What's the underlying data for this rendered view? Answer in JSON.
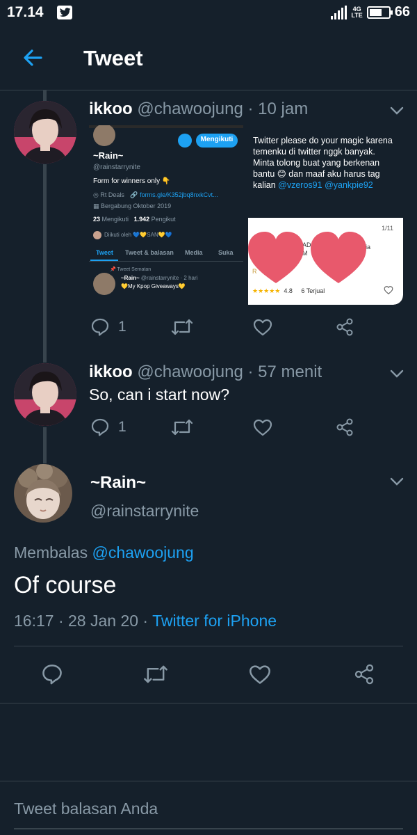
{
  "status_bar": {
    "time": "17.14",
    "network": "4G",
    "network_sub": "LTE",
    "battery": "66"
  },
  "header": {
    "title": "Tweet"
  },
  "tweets": [
    {
      "name": "ikkoo",
      "handle": "@chawoojung",
      "time": "· 10 jam",
      "reply_count": "1",
      "embed": {
        "left": {
          "follow_label": "Mengikuti",
          "profile_name": "~Rain~",
          "profile_handle": "@rainstarrynite",
          "bio": "Form for winners only 👇",
          "loc": "Rt Deals",
          "url": "forms.gle/K352jbq8nxkCvt...",
          "joined": "Bergabung Oktober 2019",
          "following_count": "23",
          "following_label": "Mengikuti",
          "followers_count": "1.942",
          "followers_label": "Pengikut",
          "followed_by": "Diikuti oleh 💙💛SAN💛💙",
          "tabs": [
            "Tweet",
            "Tweet & balasan",
            "Media",
            "Suka"
          ],
          "pinned_label": "Tweet Sematan",
          "pinned_name": "~Rain~",
          "pinned_meta": "@rainstarrynite · 2 hari",
          "pinned_text": "💛My Kpop Giveaways💛"
        },
        "right": {
          "text": "Twitter please do your magic karena temenku di twitter nggk banyak. Minta tolong buat yang berkenan bantu 😊 dan maaf aku harus tag kalian",
          "mention1": "@vzeros91",
          "mention2": "@yankpie92",
          "card_page": "1/11",
          "card_partial1": "AD",
          "card_partial2": "M",
          "card_partial3": "stalgia",
          "card_partial4": "R",
          "rating": "4.8",
          "sold": "6 Terjual"
        }
      }
    },
    {
      "name": "ikkoo",
      "handle": "@chawoojung",
      "time": "· 57 menit",
      "text": "So, can i start now?",
      "reply_count": "1"
    }
  ],
  "main_tweet": {
    "name": "~Rain~",
    "handle": "@rainstarrynite",
    "reply_prefix": "Membalas",
    "reply_to": "@chawoojung",
    "text": "Of course",
    "timestamp": "16:17 · 28 Jan 20 ·",
    "source": "Twitter for iPhone"
  },
  "reply_box": {
    "placeholder": "Tweet balasan Anda"
  },
  "colors": {
    "background": "#15202b",
    "accent": "#1da1f2",
    "muted": "#8899a6",
    "divider": "#38444d"
  }
}
